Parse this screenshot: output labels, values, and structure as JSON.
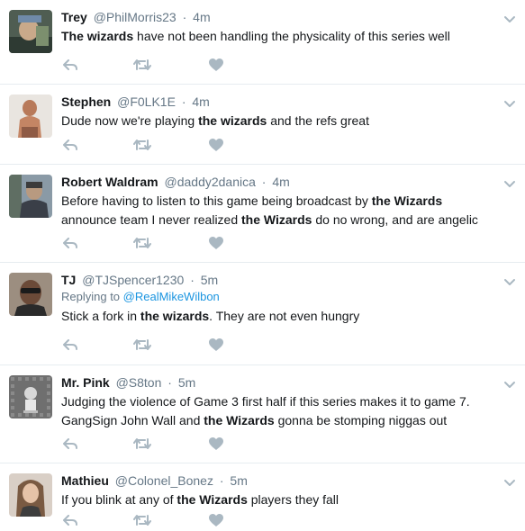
{
  "colors": {
    "text": "#14171a",
    "meta": "#657786",
    "link": "#1b95e0",
    "action_icons": "#aab8c2",
    "divider": "#e6ecf0"
  },
  "icons": {
    "reply": "reply-icon",
    "retweet": "retweet-icon",
    "like": "heart-icon",
    "menu": "chevron-down-icon"
  },
  "tweets": [
    {
      "name": "Trey",
      "handle": "@PhilMorris23",
      "time": "4m",
      "segments": [
        {
          "text": "The wizards",
          "bold": true
        },
        {
          "text": " have not been handling the physicality of this series well",
          "bold": false
        }
      ]
    },
    {
      "name": "Stephen",
      "handle": "@F0LK1E",
      "time": "4m",
      "segments": [
        {
          "text": "Dude now we're playing ",
          "bold": false
        },
        {
          "text": "the wizards",
          "bold": true
        },
        {
          "text": " and the refs great",
          "bold": false
        }
      ]
    },
    {
      "name": "Robert Waldram",
      "handle": "@daddy2danica",
      "time": "4m",
      "segments": [
        {
          "text": "Before having to listen to this game being broadcast by ",
          "bold": false
        },
        {
          "text": "the Wizards",
          "bold": true
        },
        {
          "text": " announce team I never realized ",
          "bold": false
        },
        {
          "text": "the Wizards",
          "bold": true
        },
        {
          "text": " do no wrong, and are angelic",
          "bold": false
        }
      ]
    },
    {
      "name": "TJ",
      "handle": "@TJSpencer1230",
      "time": "5m",
      "replying_label": "Replying to",
      "replying_handle": "@RealMikeWilbon",
      "segments": [
        {
          "text": "Stick a fork in ",
          "bold": false
        },
        {
          "text": "the wizards",
          "bold": true
        },
        {
          "text": ". They are not even hungry",
          "bold": false
        }
      ]
    },
    {
      "name": "Mr. Pink",
      "handle": "@S8ton",
      "time": "5m",
      "segments": [
        {
          "text": "Judging the violence of Game 3 first half if this series makes it to game 7. GangSign John Wall and ",
          "bold": false
        },
        {
          "text": "the Wizards",
          "bold": true
        },
        {
          "text": " gonna be stomping niggas out",
          "bold": false
        }
      ]
    },
    {
      "name": "Mathieu",
      "handle": "@Colonel_Bonez",
      "time": "5m",
      "segments": [
        {
          "text": "If you blink at any of ",
          "bold": false
        },
        {
          "text": "the Wizards",
          "bold": true
        },
        {
          "text": " players they fall",
          "bold": false
        }
      ]
    }
  ]
}
